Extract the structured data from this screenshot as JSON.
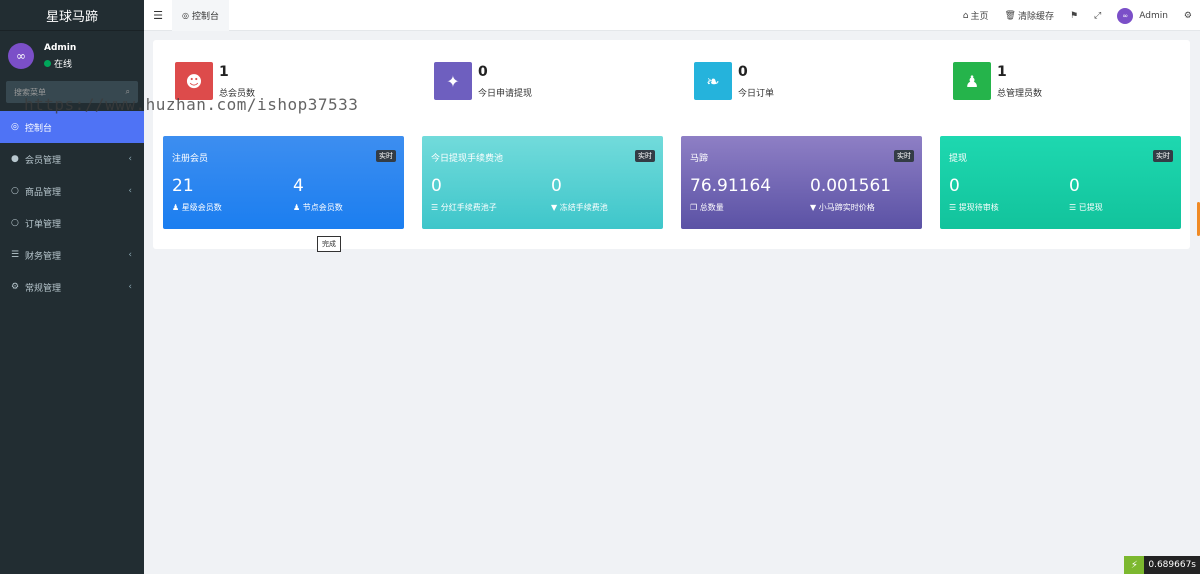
{
  "app": {
    "title": "星球马蹄"
  },
  "user": {
    "name": "Admin",
    "status": "在线"
  },
  "search": {
    "placeholder": "搜索菜单"
  },
  "menu": [
    {
      "label": "控制台",
      "icon": "dashboard-icon",
      "glyph": "◎",
      "active": true,
      "chevron": false
    },
    {
      "label": "会员管理",
      "icon": "user-circle-icon",
      "glyph": "●",
      "active": false,
      "chevron": true
    },
    {
      "label": "商品管理",
      "icon": "circle-icon",
      "glyph": "○",
      "active": false,
      "chevron": true
    },
    {
      "label": "订单管理",
      "icon": "circle-icon",
      "glyph": "○",
      "active": false,
      "chevron": false
    },
    {
      "label": "财务管理",
      "icon": "database-icon",
      "glyph": "☰",
      "active": false,
      "chevron": true
    },
    {
      "label": "常规管理",
      "icon": "cogs-icon",
      "glyph": "⚙",
      "active": false,
      "chevron": true
    }
  ],
  "header": {
    "tab_label": "控制台",
    "home_label": "主页",
    "clear_cache_label": "清除缓存",
    "admin_label": "Admin"
  },
  "stats": [
    {
      "value": "1",
      "label": "总会员数",
      "color": "#dd4b4b",
      "icon": "users-icon",
      "glyph": "👥"
    },
    {
      "value": "0",
      "label": "今日申请提现",
      "color": "#6e5fbf",
      "icon": "magic-wand-icon",
      "glyph": "✦"
    },
    {
      "value": "0",
      "label": "今日订单",
      "color": "#25b3dc",
      "icon": "leaf-icon",
      "glyph": "❧"
    },
    {
      "value": "1",
      "label": "总管理员数",
      "color": "#25b44b",
      "icon": "user-icon",
      "glyph": "👤"
    }
  ],
  "cards": [
    {
      "title": "注册会员",
      "badge": "实时",
      "gradient": [
        "#3d8ef0",
        "#1b7ef0"
      ],
      "cols": [
        {
          "value": "21",
          "label": "星级会员数",
          "icon": "user-icon"
        },
        {
          "value": "4",
          "label": "节点会员数",
          "icon": "user-icon"
        }
      ]
    },
    {
      "title": "今日提现手续费池",
      "badge": "实时",
      "gradient": [
        "#72dbdb",
        "#3ec6ca"
      ],
      "cols": [
        {
          "value": "0",
          "label": "分红手续费池子",
          "icon": "database-icon"
        },
        {
          "value": "0",
          "label": "冻结手续费池",
          "icon": "filter-icon"
        }
      ]
    },
    {
      "title": "马蹄",
      "badge": "实时",
      "gradient": [
        "#8e7fc5",
        "#5b52a5"
      ],
      "cols": [
        {
          "value": "76.91164",
          "label": "总数量",
          "icon": "clone-icon"
        },
        {
          "value": "0.001561",
          "label": "小马蹄实时价格",
          "icon": "filter-icon"
        }
      ]
    },
    {
      "title": "提现",
      "badge": "实时",
      "gradient": [
        "#1ed8b0",
        "#12c39c"
      ],
      "cols": [
        {
          "value": "0",
          "label": "提现待审核",
          "icon": "database-icon"
        },
        {
          "value": "0",
          "label": "已提现",
          "icon": "database-icon"
        }
      ]
    }
  ],
  "tooltip": "完成",
  "watermark": "https://www.huzhan.com/ishop37533",
  "timer": "0.689667s"
}
